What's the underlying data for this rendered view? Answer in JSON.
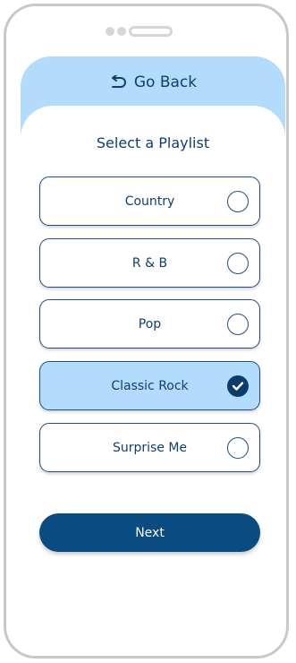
{
  "header": {
    "back_label": "Go Back",
    "icon": "undo-arrow-icon"
  },
  "title": "Select a Playlist",
  "options": [
    {
      "label": "Country",
      "selected": false
    },
    {
      "label": "R & B",
      "selected": false
    },
    {
      "label": "Pop",
      "selected": false
    },
    {
      "label": "Classic Rock",
      "selected": true
    },
    {
      "label": "Surprise Me",
      "selected": false
    }
  ],
  "next_label": "Next",
  "colors": {
    "header_bg": "#b3dbfb",
    "primary": "#0a4b82",
    "text": "#0f3f6e",
    "selected_bg": "#b3dbfb"
  }
}
